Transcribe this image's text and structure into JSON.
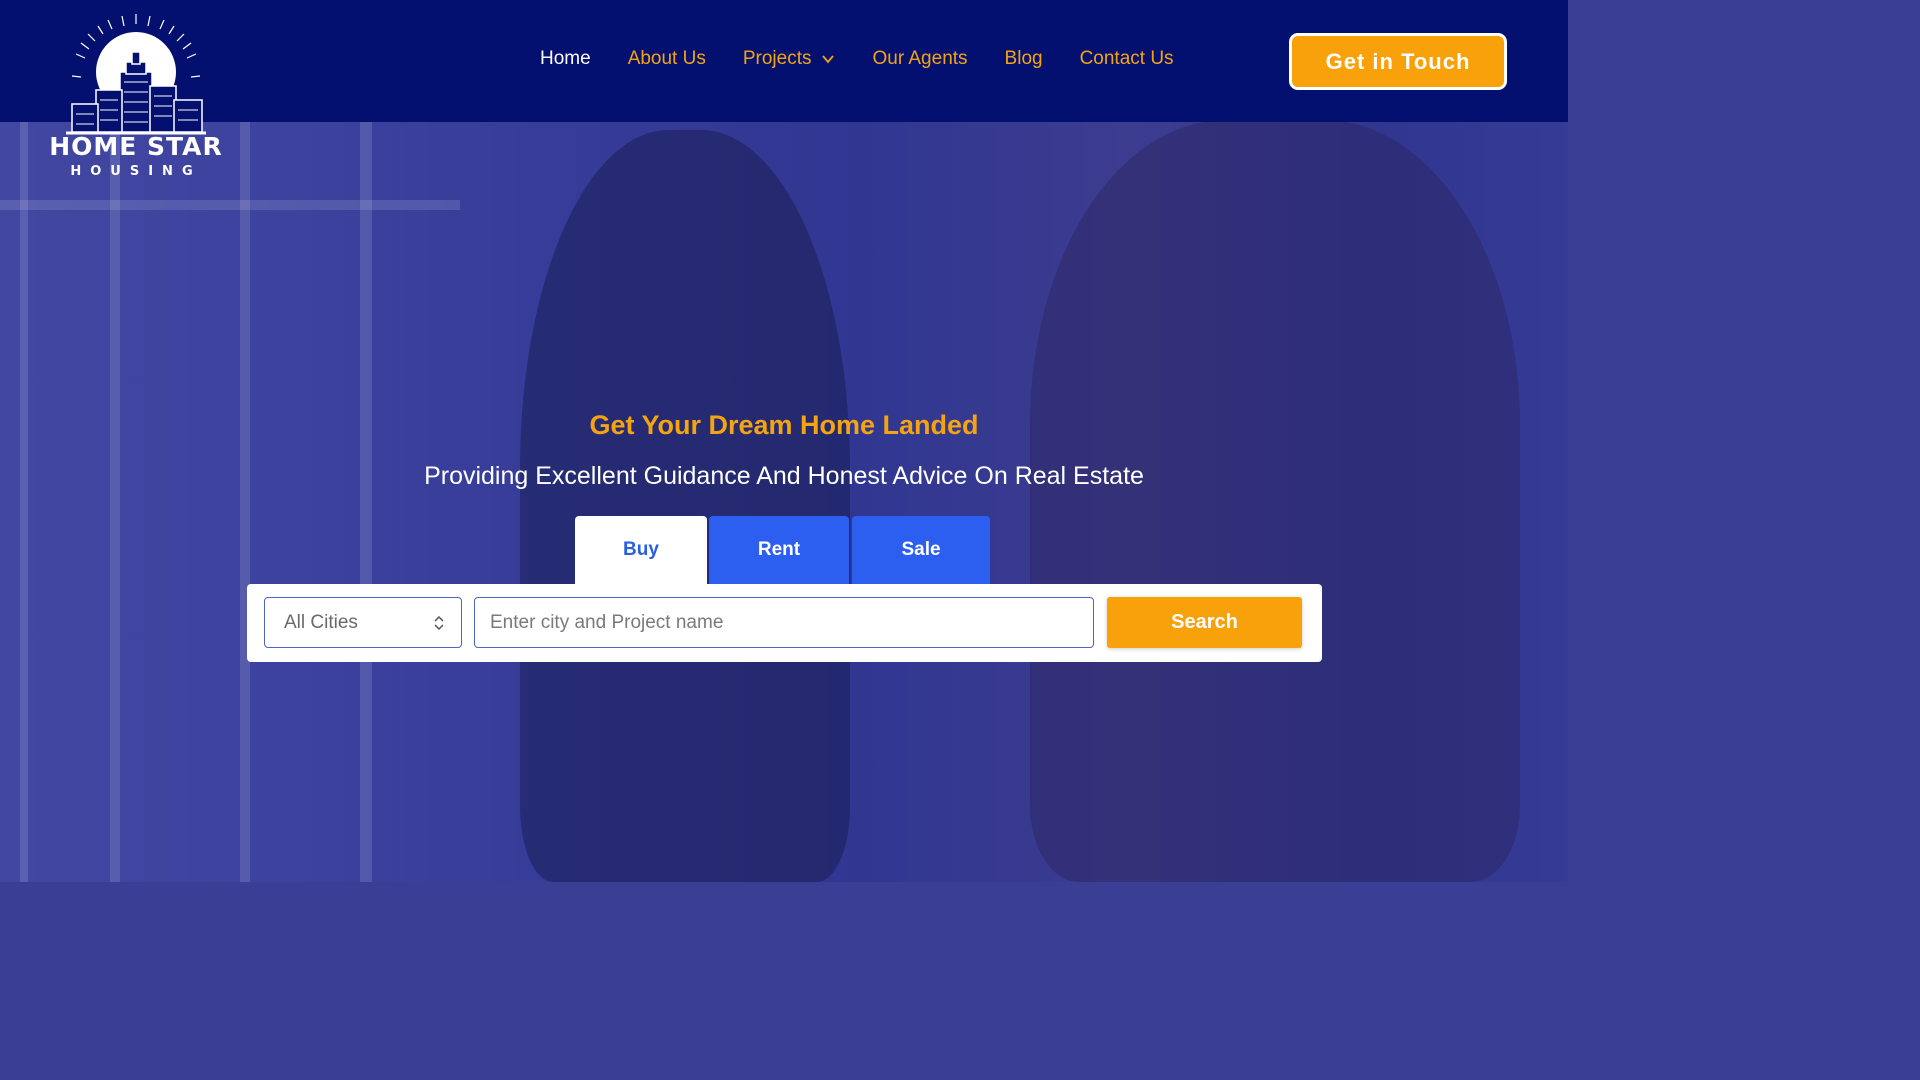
{
  "brand": {
    "name": "HOME STAR",
    "tagline": "HOUSING"
  },
  "nav": {
    "items": [
      {
        "label": "Home",
        "active": true
      },
      {
        "label": "About Us",
        "active": false
      },
      {
        "label": "Projects",
        "active": false,
        "has_dropdown": true
      },
      {
        "label": "Our Agents",
        "active": false
      },
      {
        "label": "Blog",
        "active": false
      },
      {
        "label": "Contact Us",
        "active": false
      }
    ],
    "cta_label": "Get in Touch"
  },
  "hero": {
    "headline": "Get Your Dream Home Landed",
    "subheadline": "Providing Excellent Guidance And Honest Advice On Real Estate"
  },
  "search": {
    "tabs": [
      {
        "label": "Buy",
        "selected": true
      },
      {
        "label": "Rent",
        "selected": false
      },
      {
        "label": "Sale",
        "selected": false
      }
    ],
    "city_select_value": "All Cities",
    "input_placeholder": "Enter city and Project name",
    "button_label": "Search"
  },
  "colors": {
    "header_bg": "#031070",
    "accent_orange": "#f9a10a",
    "tab_blue": "#2c5ff0",
    "hero_overlay": "#2e3496"
  },
  "icons": {
    "logo": "city-skyline-logo-icon",
    "projects_dropdown": "chevron-down-icon",
    "city_select": "select-arrows-icon"
  }
}
